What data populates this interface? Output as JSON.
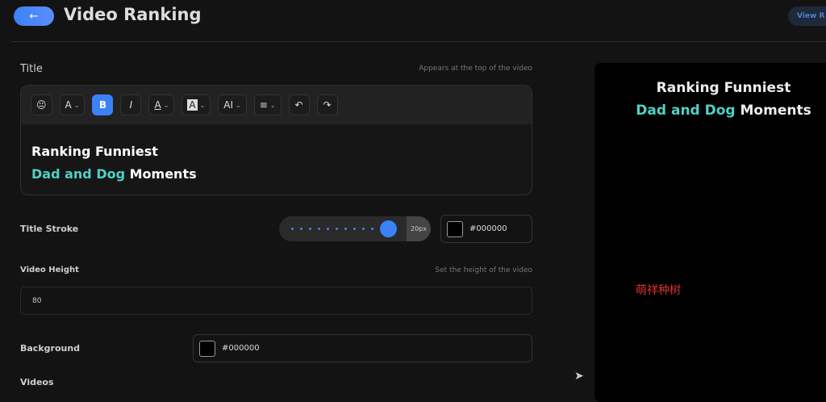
{
  "header": {
    "back_icon": "←",
    "title": "Video Ranking",
    "view_button": "View R"
  },
  "title_section": {
    "label": "Title",
    "hint": "Appears at the top of the video",
    "toolbar": [
      {
        "name": "emoji",
        "label": "😐"
      },
      {
        "name": "font-size",
        "label": "A",
        "dropdown": true
      },
      {
        "name": "bold",
        "label": "B",
        "active": true
      },
      {
        "name": "italic",
        "label": "I"
      },
      {
        "name": "text-color",
        "label": "A",
        "dropdown": true
      },
      {
        "name": "highlight",
        "label": "A",
        "dropdown": true
      },
      {
        "name": "ai",
        "label": "AI",
        "dropdown": true
      },
      {
        "name": "align",
        "label": "≡",
        "dropdown": true
      },
      {
        "name": "undo",
        "label": "↶"
      },
      {
        "name": "redo",
        "label": "↷"
      }
    ],
    "line1": "Ranking Funniest",
    "line2_highlight": "Dad and Dog",
    "line2_rest": " Moments",
    "highlight_color": "#4fd1c5"
  },
  "stroke": {
    "label": "Title Stroke",
    "value": "20px",
    "fraction": 1.0,
    "color": "#000000"
  },
  "height": {
    "label": "Video Height",
    "hint": "Set the height of the video",
    "value": "80"
  },
  "background": {
    "label": "Background",
    "color": "#000000"
  },
  "videos": {
    "label": "Videos"
  },
  "preview": {
    "line1": "Ranking Funniest",
    "line2_highlight": "Dad and Dog",
    "line2_rest": " Moments"
  },
  "watermark": "萌祥种树",
  "accent": "#3b82f6"
}
